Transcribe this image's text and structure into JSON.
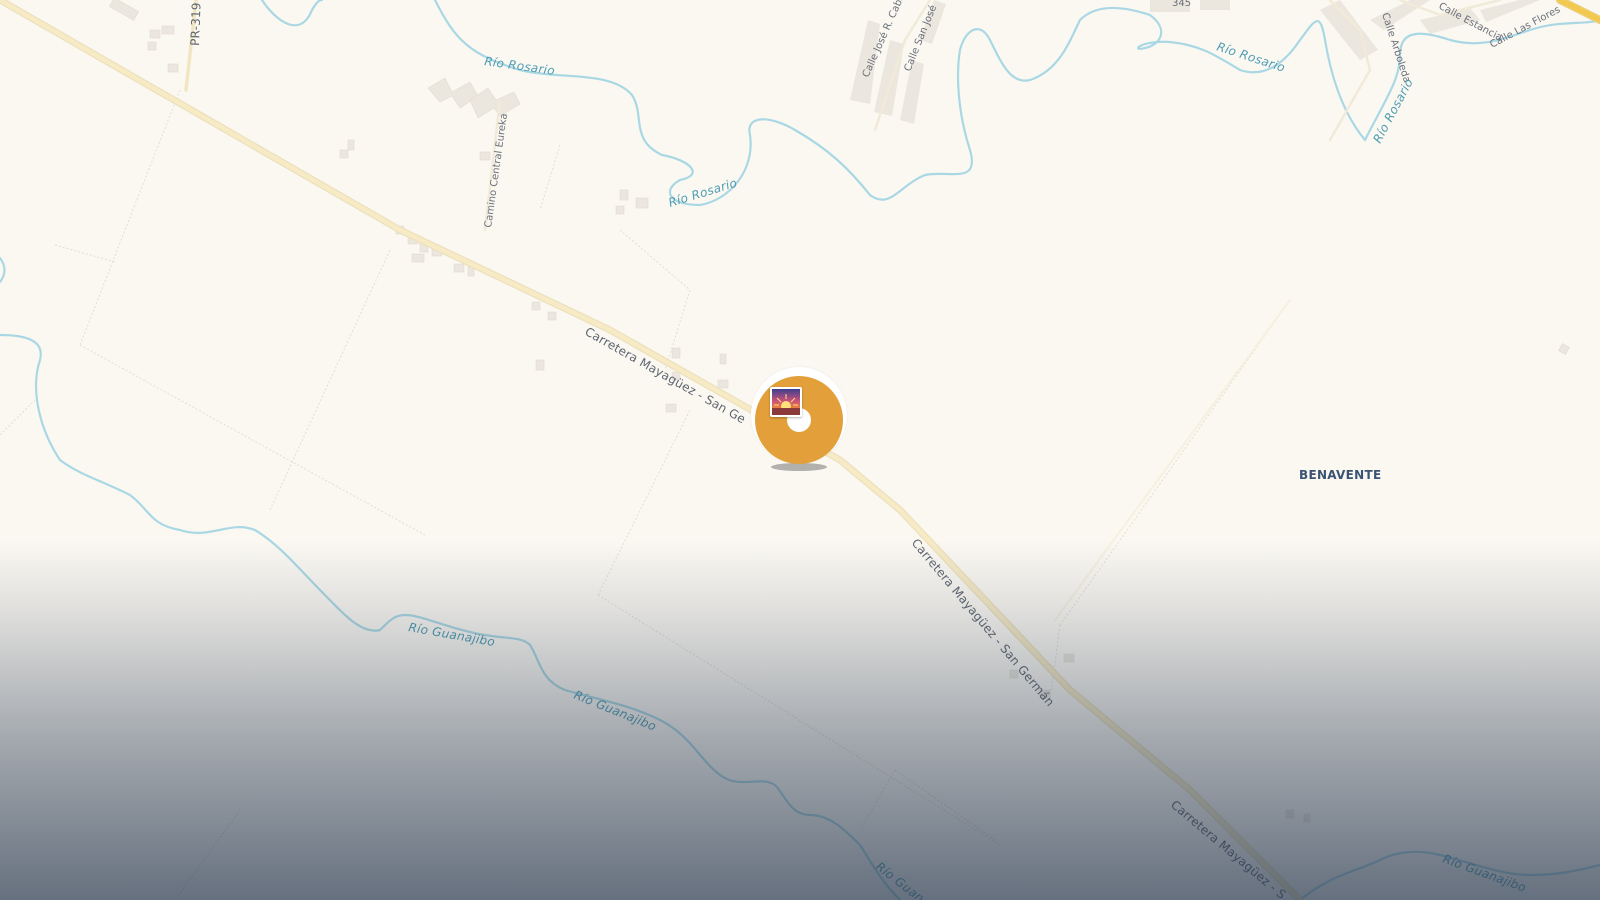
{
  "map": {
    "colors": {
      "land": "#fbf8f2",
      "river": "#a9d8e4",
      "road": "#f7ebc6",
      "road_casing": "#ece0bd",
      "highway_accent": "#f2c94c",
      "marker": "#e3a03a"
    },
    "road_labels": {
      "carretera_nw": "Carretera Mayagüez - San Ge",
      "carretera_mid": "Carretera Mayagüez - San Germán",
      "carretera_se": "Carretera Mayagüez - S",
      "pr319": "PR-319",
      "camino_eureka": "Camino Central Eureka",
      "calle_jose_r": "Calle José R. Caballe",
      "calle_san_jose": "Calle San José",
      "calle_estancia": "Calle Estancia",
      "calle_arboleda": "Calle Arboleda",
      "calle_las_flores": "Calle Las Flores",
      "route_345": "345"
    },
    "river_labels": {
      "rosario_1": "Río Rosario",
      "rosario_2": "Río Rosario",
      "rosario_3": "Río Rosario",
      "rosario_4": "Río Rosario",
      "guanajibo_1": "Río Guanajibo",
      "guanajibo_2": "Río Guanajibo",
      "guanajibo_3": "Río Guan",
      "guanajibo_4": "Río Guanajibo"
    },
    "place_labels": {
      "benavente": "BENAVENTE"
    },
    "marker": {
      "icon": "sunrise-photo-icon"
    }
  }
}
